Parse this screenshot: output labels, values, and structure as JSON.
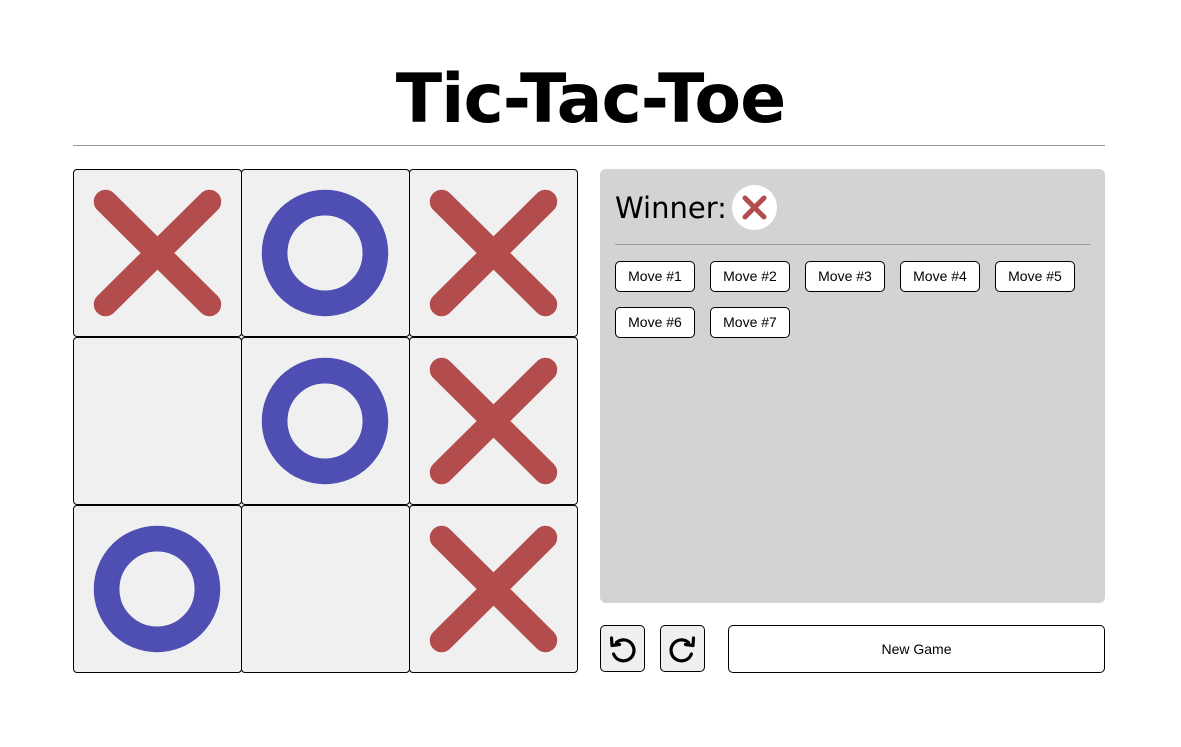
{
  "title": "Tic-Tac-Toe",
  "colors": {
    "x_mark": "#b34c4c",
    "o_mark": "#4f4fb3",
    "cell_bg": "#f0f0f0",
    "panel_bg": "#d3d3d3"
  },
  "board": {
    "cells": [
      "X",
      "O",
      "X",
      "",
      "O",
      "X",
      "O",
      "",
      "X"
    ]
  },
  "status": {
    "winner_label": "Winner:",
    "winner_mark": "X"
  },
  "history": {
    "moves": [
      "Move #1",
      "Move #2",
      "Move #3",
      "Move #4",
      "Move #5",
      "Move #6",
      "Move #7"
    ]
  },
  "controls": {
    "undo_icon": "undo-arrow-icon",
    "redo_icon": "redo-arrow-icon",
    "new_game_label": "New Game"
  }
}
